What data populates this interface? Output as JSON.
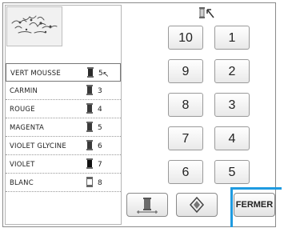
{
  "threads": [
    {
      "name": "VERT MOUSSE",
      "number": "5",
      "color": "#2b2b2b",
      "selected": true
    },
    {
      "name": "CARMIN",
      "number": "3",
      "color": "#3a3a3a"
    },
    {
      "name": "ROUGE",
      "number": "4",
      "color": "#3a3a3a"
    },
    {
      "name": "MAGENTA",
      "number": "5",
      "color": "#3a3a3a"
    },
    {
      "name": "VIOLET GLYCINE",
      "number": "6",
      "color": "#3a3a3a"
    },
    {
      "name": "VIOLET",
      "number": "7",
      "color": "#111111"
    },
    {
      "name": "BLANC",
      "number": "8",
      "color": "#ffffff"
    }
  ],
  "keypad": {
    "k10": "10",
    "k1": "1",
    "k9": "9",
    "k2": "2",
    "k8": "8",
    "k3": "3",
    "k7": "7",
    "k4": "4",
    "k6": "6",
    "k5": "5"
  },
  "bottom": {
    "close_label": "FERMER"
  },
  "colors": {
    "highlight": "#1f9be0",
    "button_border": "#9a9a9a"
  }
}
